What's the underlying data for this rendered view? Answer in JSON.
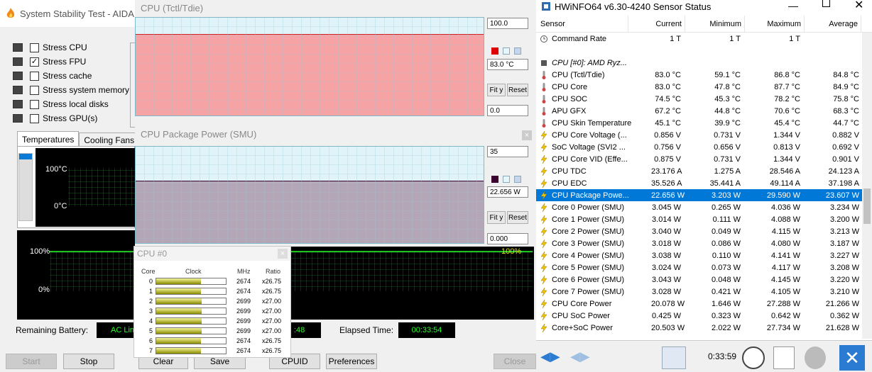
{
  "aida": {
    "title": "System Stability Test - AIDA",
    "stress": [
      {
        "label": "Stress CPU",
        "checked": false,
        "icon": "cpu-chip-icon"
      },
      {
        "label": "Stress FPU",
        "checked": true,
        "icon": "fpu-icon"
      },
      {
        "label": "Stress cache",
        "checked": false,
        "icon": "cache-icon"
      },
      {
        "label": "Stress system memory",
        "checked": false,
        "icon": "memory-icon"
      },
      {
        "label": "Stress local disks",
        "checked": false,
        "icon": "disk-icon"
      },
      {
        "label": "Stress GPU(s)",
        "checked": false,
        "icon": "gpu-monitor-icon"
      }
    ],
    "tabs": [
      "Temperatures",
      "Cooling Fans"
    ],
    "temp_top": "100°C",
    "temp_bottom": "0°C",
    "util_top": "100%",
    "util_bottom": "0%",
    "util_right": "100%",
    "remaining_battery_label": "Remaining Battery:",
    "remaining_battery_value": "AC Line",
    "test_started_value": ":48",
    "elapsed_label": "Elapsed Time:",
    "elapsed_value": "00:33:54",
    "buttons": {
      "start": "Start",
      "stop": "Stop",
      "clear": "Clear",
      "save": "Save",
      "cpuid": "CPUID",
      "preferences": "Preferences",
      "close": "Close"
    }
  },
  "graph1": {
    "title": "CPU (Tctl/Tdie)",
    "max": "100.0",
    "current": "83.0 °C",
    "min": "0.0",
    "fit": "Fit y",
    "reset": "Reset",
    "level": 0.83,
    "fill": "#f6a3a5"
  },
  "graph2": {
    "title": "CPU Package Power (SMU)",
    "max": "35",
    "current": "22.656 W",
    "min": "0.000",
    "fit": "Fit y",
    "reset": "Reset",
    "level": 0.647,
    "fill": "#b3a6b6"
  },
  "cpu0": {
    "title": "CPU #0",
    "headers": {
      "core": "Core",
      "clock": "Clock",
      "mhz": "MHz",
      "ratio": "Ratio"
    },
    "cores": [
      {
        "core": "0",
        "mhz": "2674",
        "ratio": "x26.75",
        "fill": 0.64
      },
      {
        "core": "1",
        "mhz": "2674",
        "ratio": "x26.75",
        "fill": 0.64
      },
      {
        "core": "2",
        "mhz": "2699",
        "ratio": "x27.00",
        "fill": 0.65
      },
      {
        "core": "3",
        "mhz": "2699",
        "ratio": "x27.00",
        "fill": 0.65
      },
      {
        "core": "4",
        "mhz": "2699",
        "ratio": "x27.00",
        "fill": 0.65
      },
      {
        "core": "5",
        "mhz": "2699",
        "ratio": "x27.00",
        "fill": 0.65
      },
      {
        "core": "6",
        "mhz": "2674",
        "ratio": "x26.75",
        "fill": 0.64
      },
      {
        "core": "7",
        "mhz": "2674",
        "ratio": "x26.75",
        "fill": 0.64
      }
    ]
  },
  "hwinfo": {
    "title": "HWiNFO64 v6.30-4240 Sensor Status",
    "columns": [
      "Sensor",
      "Current",
      "Minimum",
      "Maximum",
      "Average"
    ],
    "rows": [
      {
        "name": "Command Rate",
        "cur": "1 T",
        "min": "1 T",
        "max": "1 T",
        "avg": "",
        "icon": "clock-icon"
      },
      {
        "name": "",
        "cur": "",
        "min": "",
        "max": "",
        "avg": "",
        "icon": "none"
      },
      {
        "name": "CPU [#0]: AMD Ryz...",
        "cur": "",
        "min": "",
        "max": "",
        "avg": "",
        "icon": "chip-icon",
        "group": true
      },
      {
        "name": "CPU (Tctl/Tdie)",
        "cur": "83.0 °C",
        "min": "59.1 °C",
        "max": "86.8 °C",
        "avg": "84.8 °C",
        "icon": "thermometer-icon"
      },
      {
        "name": "CPU Core",
        "cur": "83.0 °C",
        "min": "47.8 °C",
        "max": "87.7 °C",
        "avg": "84.9 °C",
        "icon": "thermometer-icon"
      },
      {
        "name": "CPU SOC",
        "cur": "74.5 °C",
        "min": "45.3 °C",
        "max": "78.2 °C",
        "avg": "75.8 °C",
        "icon": "thermometer-icon"
      },
      {
        "name": "APU GFX",
        "cur": "67.2 °C",
        "min": "44.8 °C",
        "max": "70.6 °C",
        "avg": "68.3 °C",
        "icon": "thermometer-icon"
      },
      {
        "name": "CPU Skin Temperature",
        "cur": "45.1 °C",
        "min": "39.9 °C",
        "max": "45.4 °C",
        "avg": "44.7 °C",
        "icon": "thermometer-icon"
      },
      {
        "name": "CPU Core Voltage (...",
        "cur": "0.856 V",
        "min": "0.731 V",
        "max": "1.344 V",
        "avg": "0.882 V",
        "icon": "lightning-icon"
      },
      {
        "name": "SoC Voltage (SVI2 ...",
        "cur": "0.756 V",
        "min": "0.656 V",
        "max": "0.813 V",
        "avg": "0.692 V",
        "icon": "lightning-icon"
      },
      {
        "name": "CPU Core VID (Effe...",
        "cur": "0.875 V",
        "min": "0.731 V",
        "max": "1.344 V",
        "avg": "0.901 V",
        "icon": "lightning-icon"
      },
      {
        "name": "CPU TDC",
        "cur": "23.176 A",
        "min": "1.275 A",
        "max": "28.546 A",
        "avg": "24.123 A",
        "icon": "lightning-icon"
      },
      {
        "name": "CPU EDC",
        "cur": "35.526 A",
        "min": "35.441 A",
        "max": "49.114 A",
        "avg": "37.198 A",
        "icon": "lightning-icon"
      },
      {
        "name": "CPU Package Powe...",
        "cur": "22.656 W",
        "min": "3.203 W",
        "max": "29.590 W",
        "avg": "23.607 W",
        "icon": "lightning-icon",
        "sel": true
      },
      {
        "name": "Core 0 Power (SMU)",
        "cur": "3.045 W",
        "min": "0.265 W",
        "max": "4.036 W",
        "avg": "3.234 W",
        "icon": "lightning-icon"
      },
      {
        "name": "Core 1 Power (SMU)",
        "cur": "3.014 W",
        "min": "0.111 W",
        "max": "4.088 W",
        "avg": "3.200 W",
        "icon": "lightning-icon"
      },
      {
        "name": "Core 2 Power (SMU)",
        "cur": "3.040 W",
        "min": "0.049 W",
        "max": "4.115 W",
        "avg": "3.213 W",
        "icon": "lightning-icon"
      },
      {
        "name": "Core 3 Power (SMU)",
        "cur": "3.018 W",
        "min": "0.086 W",
        "max": "4.080 W",
        "avg": "3.187 W",
        "icon": "lightning-icon"
      },
      {
        "name": "Core 4 Power (SMU)",
        "cur": "3.038 W",
        "min": "0.110 W",
        "max": "4.141 W",
        "avg": "3.227 W",
        "icon": "lightning-icon"
      },
      {
        "name": "Core 5 Power (SMU)",
        "cur": "3.024 W",
        "min": "0.073 W",
        "max": "4.117 W",
        "avg": "3.208 W",
        "icon": "lightning-icon"
      },
      {
        "name": "Core 6 Power (SMU)",
        "cur": "3.043 W",
        "min": "0.048 W",
        "max": "4.145 W",
        "avg": "3.220 W",
        "icon": "lightning-icon"
      },
      {
        "name": "Core 7 Power (SMU)",
        "cur": "3.028 W",
        "min": "0.421 W",
        "max": "4.105 W",
        "avg": "3.210 W",
        "icon": "lightning-icon"
      },
      {
        "name": "CPU Core Power",
        "cur": "20.078 W",
        "min": "1.646 W",
        "max": "27.288 W",
        "avg": "21.266 W",
        "icon": "lightning-icon"
      },
      {
        "name": "CPU SoC Power",
        "cur": "0.425 W",
        "min": "0.323 W",
        "max": "0.642 W",
        "avg": "0.362 W",
        "icon": "lightning-icon"
      },
      {
        "name": "Core+SoC Power",
        "cur": "20.503 W",
        "min": "2.022 W",
        "max": "27.734 W",
        "avg": "21.628 W",
        "icon": "lightning-icon"
      }
    ],
    "footer_time": "0:33:59"
  },
  "colors": {
    "accent": "#0078d7",
    "graph_green": "#2bff2b",
    "temp_fill": "#f6a3a5",
    "power_fill": "#b3a6b6"
  }
}
